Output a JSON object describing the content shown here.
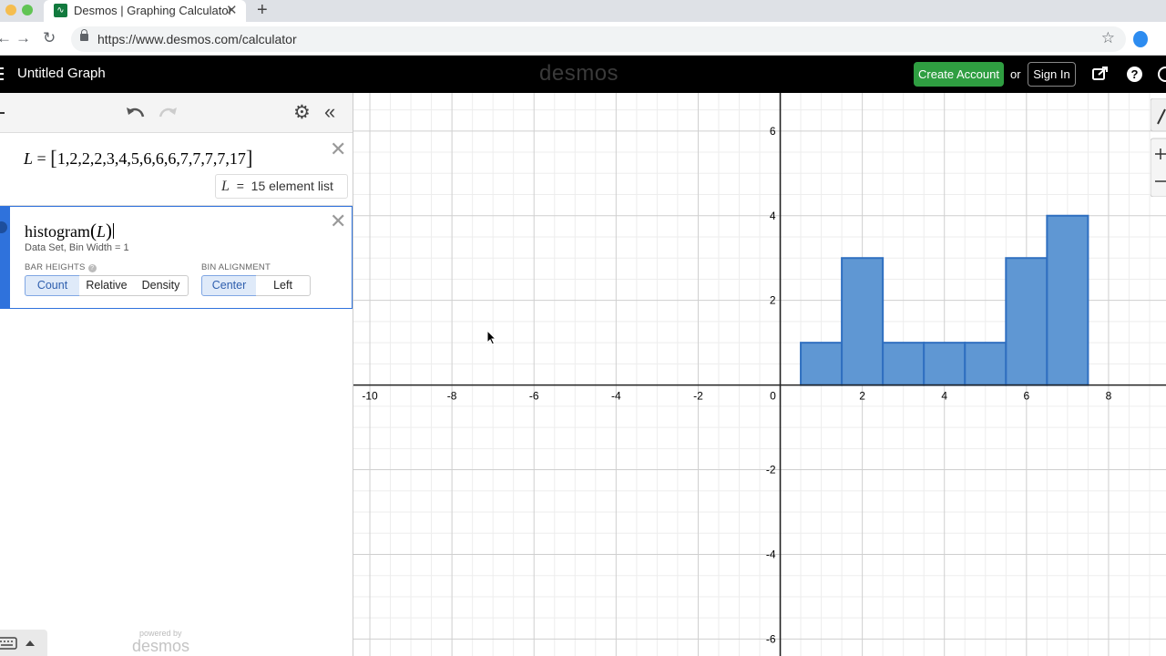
{
  "browser": {
    "tab_title": "Desmos | Graphing Calculator",
    "url": "https://www.desmos.com/calculator"
  },
  "header": {
    "graph_title": "Untitled Graph",
    "logo": "desmos",
    "create_account": "Create Account",
    "or": "or",
    "sign_in": "Sign In"
  },
  "expressions": {
    "list_expr": {
      "var": "L",
      "values": "1,2,2,2,3,4,5,6,6,6,7,7,7,7,17",
      "evaluation_var": "L",
      "evaluation_eq": "=",
      "evaluation_text": "15 element list"
    },
    "histogram_expr": {
      "func": "histogram",
      "arg": "L",
      "meta_left": "Data Set,",
      "meta_right": "Bin Width = 1",
      "bar_heights_label": "BAR HEIGHTS",
      "bar_heights_options": [
        "Count",
        "Relative",
        "Density"
      ],
      "bar_heights_selected": "Count",
      "bin_alignment_label": "BIN ALIGNMENT",
      "bin_alignment_options": [
        "Center",
        "Left"
      ],
      "bin_alignment_selected": "Center"
    }
  },
  "footer": {
    "powered_by": "powered by",
    "logo": "desmos"
  },
  "chart_data": {
    "type": "bar",
    "x_tick_labels": [
      "-10",
      "-8",
      "-6",
      "-4",
      "-2",
      "0",
      "2",
      "4",
      "6",
      "8"
    ],
    "y_tick_labels": [
      "6",
      "4",
      "2",
      "-2",
      "-4",
      "-6"
    ],
    "bins": [
      {
        "center": 1,
        "count": 1
      },
      {
        "center": 2,
        "count": 3
      },
      {
        "center": 3,
        "count": 1
      },
      {
        "center": 4,
        "count": 1
      },
      {
        "center": 5,
        "count": 1
      },
      {
        "center": 6,
        "count": 3
      },
      {
        "center": 7,
        "count": 4
      }
    ],
    "bin_width": 1,
    "xlim": [
      -10.4,
      9.4
    ],
    "ylim": [
      -6.4,
      6.9
    ],
    "grid": true,
    "bar_fill": "#5f97d3",
    "bar_stroke": "#2f6fc0"
  }
}
